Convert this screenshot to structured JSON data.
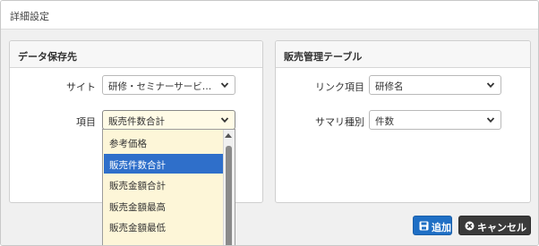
{
  "dialog": {
    "title": "詳細設定"
  },
  "data_panel": {
    "heading": "データ保存先",
    "site_label": "サイト",
    "site_value": "研修・セミナーサービス…",
    "item_label": "項目",
    "item_value": "販売件数合計",
    "dropdown_options": [
      "参考価格",
      "販売件数合計",
      "販売金額合計",
      "販売金額最高",
      "販売金額最低"
    ],
    "dropdown_selected_index": 1
  },
  "sales_panel": {
    "heading": "販売管理テーブル",
    "link_label": "リンク項目",
    "link_value": "研修名",
    "summary_label": "サマリ種別",
    "summary_value": "件数"
  },
  "buttons": {
    "add": "追加",
    "cancel": "キャンセル"
  },
  "colors": {
    "primary": "#1f6fc5",
    "selected_option": "#2f6fca",
    "dropdown_bg": "#fdf6d8",
    "cancel": "#3a3a3a"
  },
  "icons": {
    "save": "save-icon",
    "cancel": "cancel-icon",
    "chevron": "chevron-down-icon",
    "scroll_up": "scroll-up-arrow-icon"
  }
}
